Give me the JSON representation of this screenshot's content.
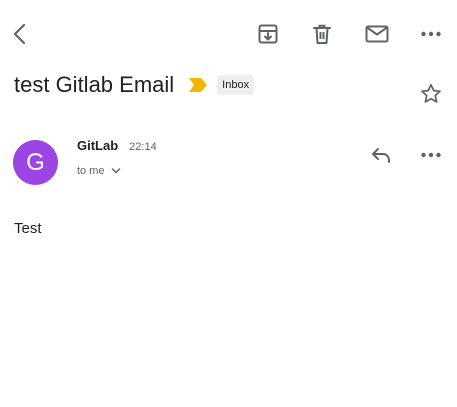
{
  "toolbar": {
    "back_icon": "arrow-back-icon",
    "archive_icon": "archive-icon",
    "delete_icon": "trash-icon",
    "mark_unread_icon": "mail-icon",
    "more_icon": "more-horizontal-icon"
  },
  "email": {
    "subject": "test Gitlab Email",
    "label": "Inbox",
    "importance_color": "#f4b400",
    "star_icon": "star-outline-icon"
  },
  "message": {
    "avatar_letter": "G",
    "avatar_color": "#9b46e4",
    "sender": "GitLab",
    "time": "22:14",
    "recipient": "to me",
    "reply_icon": "reply-icon",
    "more_icon": "more-horizontal-icon",
    "body": "Test"
  }
}
